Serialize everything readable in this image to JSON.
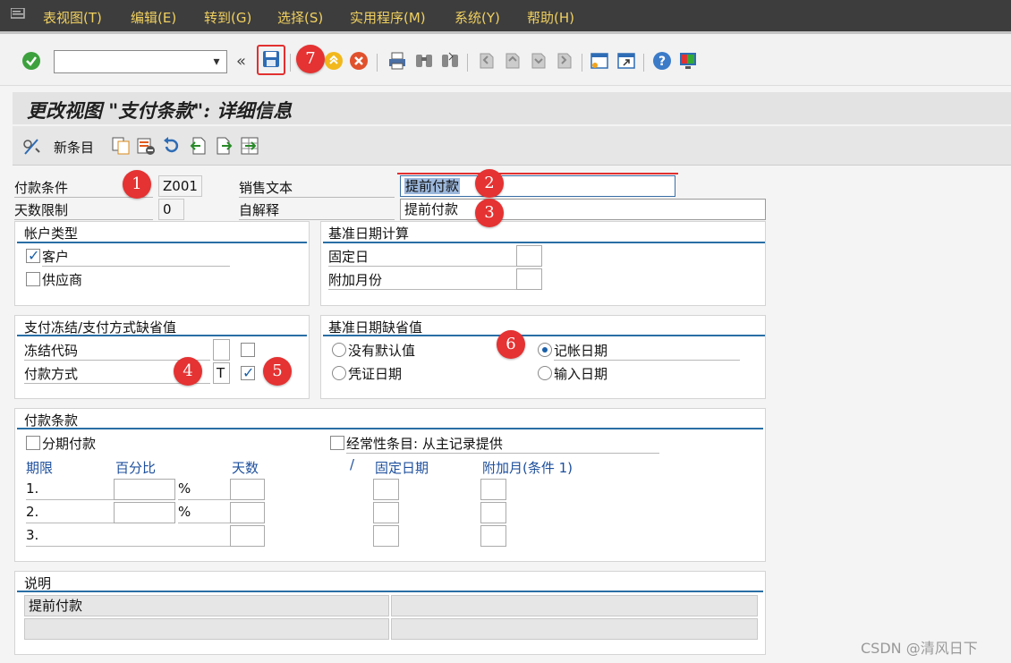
{
  "menu": [
    "表视图(T)",
    "编辑(E)",
    "转到(G)",
    "选择(S)",
    "实用程序(M)",
    "系统(Y)",
    "帮助(H)"
  ],
  "toolbar": {
    "command_value": "",
    "nav_back": "«"
  },
  "title": "更改视图 \"支付条款\": 详细信息",
  "app_toolbar": {
    "new_entries": "新条目"
  },
  "header": {
    "payment_terms_label": "付款条件",
    "payment_terms_value": "Z001",
    "day_limit_label": "天数限制",
    "day_limit_value": "0",
    "sales_text_label": "销售文本",
    "sales_text_value": "提前付款",
    "own_expl_label": "自解释",
    "own_expl_value": "提前付款"
  },
  "account_type": {
    "title": "帐户类型",
    "customer": "客户",
    "vendor": "供应商",
    "customer_checked": true,
    "vendor_checked": false
  },
  "baseline_calc": {
    "title": "基准日期计算",
    "fixed_day": "固定日",
    "additional_months": "附加月份"
  },
  "payment_block": {
    "title": "支付冻结/支付方式缺省值",
    "block_key": "冻结代码",
    "payment_method": "付款方式",
    "payment_method_value": "T",
    "method_checked": true
  },
  "baseline_default": {
    "title": "基准日期缺省值",
    "no_default": "没有默认值",
    "document_date": "凭证日期",
    "posting_date": "记帐日期",
    "entry_date": "输入日期",
    "selected": "posting_date"
  },
  "terms": {
    "title": "付款条款",
    "installment": "分期付款",
    "recurring": "经常性条目: 从主记录提供",
    "col_term": "期限",
    "col_percent": "百分比",
    "col_days": "天数",
    "col_slash": "/",
    "col_fixed_date": "固定日期",
    "col_add_month": "附加月(条件 1)",
    "rows": [
      "1.",
      "2.",
      "3."
    ],
    "percent_sign": "%"
  },
  "explanation": {
    "title": "说明",
    "line1": "提前付款",
    "line2": ""
  },
  "markers": [
    "1",
    "2",
    "3",
    "4",
    "5",
    "6",
    "7"
  ],
  "watermark": "CSDN @清风日下",
  "colors": {
    "menubar": "#3d3d3d",
    "menu_text": "#f0d060",
    "group_rule": "#2a6ea6",
    "marker": "#e53232",
    "label_blue": "#1d4f9c"
  }
}
